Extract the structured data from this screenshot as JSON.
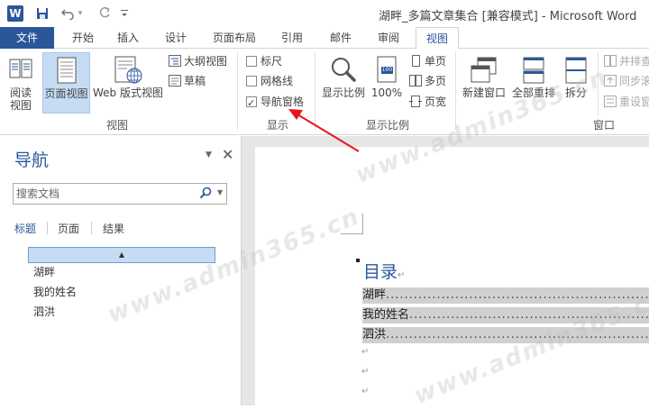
{
  "titlebar": {
    "window_title": "湖畔_多篇文章集合 [兼容模式] - Microsoft Word",
    "word_logo": "W",
    "icons": [
      "word-logo-icon",
      "save-icon",
      "undo-icon",
      "redo-icon",
      "customize-qat-icon"
    ]
  },
  "tabs": {
    "file": "文件",
    "items": [
      "开始",
      "插入",
      "设计",
      "页面布局",
      "引用",
      "邮件",
      "审阅",
      "视图"
    ],
    "active": "视图"
  },
  "ribbon": {
    "views": {
      "read_mode": "阅读\n视图",
      "print_layout": "页面视图",
      "web_layout": "Web 版式视图",
      "outline": "大纲视图",
      "draft": "草稿",
      "group_label": "视图"
    },
    "show": {
      "ruler": "标尺",
      "gridlines": "网格线",
      "nav_pane": "导航窗格",
      "ruler_checked": false,
      "gridlines_checked": false,
      "nav_pane_checked": true,
      "group_label": "显示"
    },
    "zoom": {
      "zoom": "显示比例",
      "hundred": "100%",
      "hundred_icon_text": "100",
      "one_page": "单页",
      "multiple_pages": "多页",
      "page_width": "页宽",
      "group_label": "显示比例"
    },
    "window": {
      "new_window": "新建窗口",
      "arrange_all": "全部重排",
      "split": "拆分",
      "side_by_side": "并排查",
      "sync_scroll": "同步滚",
      "reset_position": "重设窗",
      "group_label": "窗口"
    }
  },
  "navpane": {
    "title": "导航",
    "search_placeholder": "搜索文档",
    "tabs": [
      "标题",
      "页面",
      "结果"
    ],
    "active_tab": "标题",
    "collapse_glyph": "▲",
    "headings": [
      "湖畔",
      "我的姓名",
      "泗洪"
    ]
  },
  "document": {
    "toc_title": "目录",
    "toc_entries": [
      "湖畔",
      "我的姓名",
      "泗洪"
    ],
    "toc_leader": "...............................................................................................",
    "pilcrow": "↵"
  },
  "watermark": "www.admin365.cn",
  "colors": {
    "brand_blue": "#2b579a",
    "selection_blue": "#c5dcf3",
    "annotation_red": "#e8141c"
  }
}
